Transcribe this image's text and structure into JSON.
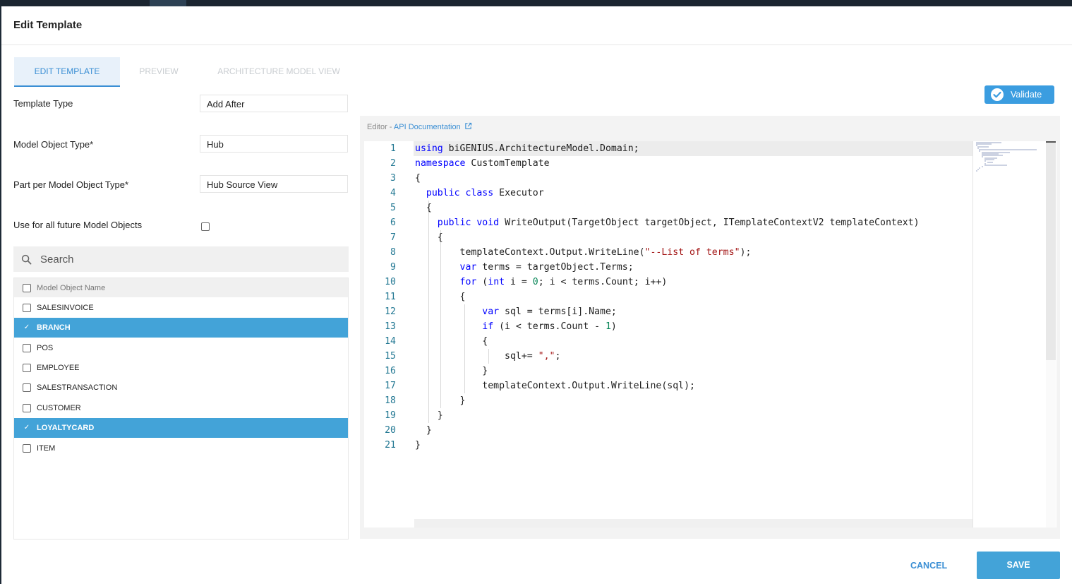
{
  "dialog": {
    "title": "Edit Template"
  },
  "tabs": [
    {
      "label": "EDIT TEMPLATE",
      "active": true
    },
    {
      "label": "PREVIEW",
      "active": false
    },
    {
      "label": "ARCHITECTURE MODEL VIEW",
      "active": false
    }
  ],
  "form": {
    "template_type": {
      "label": "Template Type",
      "value": "Add After"
    },
    "model_object_type": {
      "label": "Model Object Type*",
      "value": "Hub"
    },
    "part_per_model_object_type": {
      "label": "Part per Model Object Type*",
      "value": "Hub Source View"
    },
    "use_for_future": {
      "label": "Use for all future Model Objects",
      "checked": false
    }
  },
  "search": {
    "placeholder": "Search",
    "icon": "search-icon"
  },
  "model_objects": {
    "header": "Model Object Name",
    "items": [
      {
        "name": "SALESINVOICE",
        "selected": false
      },
      {
        "name": "BRANCH",
        "selected": true
      },
      {
        "name": "POS",
        "selected": false
      },
      {
        "name": "EMPLOYEE",
        "selected": false
      },
      {
        "name": "SALESTRANSACTION",
        "selected": false
      },
      {
        "name": "CUSTOMER",
        "selected": false
      },
      {
        "name": "LOYALTYCARD",
        "selected": true
      },
      {
        "name": "ITEM",
        "selected": false
      }
    ]
  },
  "validate": {
    "label": "Validate",
    "icon": "check-circle-icon"
  },
  "editor": {
    "caption_prefix": "Editor - ",
    "api_link": "API Documentation",
    "link_icon": "external-link-icon",
    "lines": [
      "using biGENIUS.ArchitectureModel.Domain;",
      "namespace CustomTemplate",
      "{",
      "  public class Executor",
      "  {",
      "    public void WriteOutput(TargetObject targetObject, ITemplateContextV2 templateContext)",
      "    {",
      "        templateContext.Output.WriteLine(\"--List of terms\");",
      "        var terms = targetObject.Terms;",
      "        for (int i = 0; i < terms.Count; i++)",
      "        {",
      "            var sql = terms[i].Name;",
      "            if (i < terms.Count - 1)",
      "            {",
      "                sql+= \",\";",
      "            }",
      "            templateContext.Output.WriteLine(sql);",
      "        }",
      "    }",
      "  }",
      "}"
    ]
  },
  "footer": {
    "cancel_label": "CANCEL",
    "save_label": "SAVE"
  },
  "colors": {
    "accent": "#3b8fd4",
    "selected_row": "#43a3d8",
    "keyword": "#0000ff",
    "string": "#a31515",
    "number": "#098658",
    "line_number": "#237893"
  }
}
